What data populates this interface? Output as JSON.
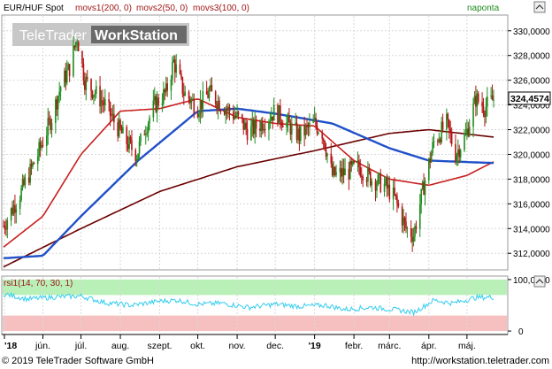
{
  "header": {
    "legend_instrument": "EUR/HUF Spot",
    "legend_ma1": "movs1(200, 0)",
    "legend_ma2": "movs2(50, 0)",
    "legend_ma3": "movs3(100, 0)",
    "period": "naponta",
    "watermark_text_1": "TeleTrader",
    "watermark_text_2": "WorkStation"
  },
  "footer": {
    "copyright": "© 2019 TeleTrader Software GmbH",
    "website": "http://workstation.teletrader.com"
  },
  "colors": {
    "candle_up": "#1e8c1e",
    "candle_down": "#b41414",
    "ma200": "#6b0000",
    "ma50": "#c81e1e",
    "ma100": "#2050c8",
    "rsi_line": "#33ccee",
    "rsi_overbought_band": "#b8f0b8",
    "rsi_oversold_band": "#f6c0c0",
    "last_price_box": "#ffffff"
  },
  "chart_data": [
    {
      "type": "candlestick",
      "series_name": "EUR/HUF Spot",
      "frequency": "naponta",
      "last_value": "324,4574",
      "ylim": [
        310.8,
        331.2
      ],
      "y_ticks": [
        "312,0000",
        "314,0000",
        "316,0000",
        "318,0000",
        "320,0000",
        "322,0000",
        "324,0000",
        "326,0000",
        "328,0000",
        "330,0000"
      ],
      "y_tick_values": [
        312,
        314,
        316,
        318,
        320,
        322,
        324,
        326,
        328,
        330
      ],
      "x_tick_labels": [
        "'18",
        "jún.",
        "júl.",
        "aug.",
        "szept.",
        "okt.",
        "nov.",
        "dec.",
        "'19",
        "febr.",
        "márc.",
        "ápr.",
        "máj."
      ],
      "close_anchors": [
        [
          "2018-05-01",
          314.2
        ],
        [
          "2018-05-15",
          317.0
        ],
        [
          "2018-05-28",
          320.0
        ],
        [
          "2018-06-08",
          323.0
        ],
        [
          "2018-06-15",
          325.5
        ],
        [
          "2018-06-22",
          327.0
        ],
        [
          "2018-06-28",
          329.5
        ],
        [
          "2018-07-04",
          326.0
        ],
        [
          "2018-07-12",
          325.0
        ],
        [
          "2018-07-20",
          324.0
        ],
        [
          "2018-07-28",
          322.5
        ],
        [
          "2018-08-06",
          321.0
        ],
        [
          "2018-08-14",
          320.0
        ],
        [
          "2018-08-20",
          322.0
        ],
        [
          "2018-08-28",
          324.0
        ],
        [
          "2018-09-06",
          325.0
        ],
        [
          "2018-09-12",
          327.5
        ],
        [
          "2018-09-20",
          325.0
        ],
        [
          "2018-10-01",
          323.8
        ],
        [
          "2018-10-10",
          325.0
        ],
        [
          "2018-10-20",
          324.0
        ],
        [
          "2018-11-01",
          323.0
        ],
        [
          "2018-11-10",
          321.8
        ],
        [
          "2018-11-20",
          322.5
        ],
        [
          "2018-12-01",
          323.5
        ],
        [
          "2018-12-10",
          322.5
        ],
        [
          "2018-12-20",
          321.5
        ],
        [
          "2019-01-01",
          322.5
        ],
        [
          "2019-01-07",
          321.8
        ],
        [
          "2019-01-15",
          318.3
        ],
        [
          "2019-01-25",
          318.5
        ],
        [
          "2019-02-05",
          319.0
        ],
        [
          "2019-02-15",
          318.0
        ],
        [
          "2019-02-25",
          317.5
        ],
        [
          "2019-03-05",
          316.5
        ],
        [
          "2019-03-14",
          314.0
        ],
        [
          "2019-03-20",
          313.5
        ],
        [
          "2019-03-28",
          317.5
        ],
        [
          "2019-04-05",
          321.0
        ],
        [
          "2019-04-15",
          322.5
        ],
        [
          "2019-04-22",
          320.0
        ],
        [
          "2019-04-30",
          321.5
        ],
        [
          "2019-05-08",
          324.5
        ],
        [
          "2019-05-15",
          323.8
        ],
        [
          "2019-05-22",
          324.46
        ]
      ],
      "ma200_anchors": [
        [
          "2018-05-01",
          310.9
        ],
        [
          "2018-07-01",
          314.0
        ],
        [
          "2018-09-01",
          317.0
        ],
        [
          "2018-11-01",
          319.0
        ],
        [
          "2019-01-01",
          320.3
        ],
        [
          "2019-03-01",
          321.7
        ],
        [
          "2019-04-01",
          322.0
        ],
        [
          "2019-05-22",
          321.4
        ]
      ],
      "ma100_anchors": [
        [
          "2018-05-01",
          311.6
        ],
        [
          "2018-06-01",
          311.8
        ],
        [
          "2018-07-01",
          315.0
        ],
        [
          "2018-08-15",
          319.5
        ],
        [
          "2018-10-01",
          323.5
        ],
        [
          "2018-11-01",
          323.7
        ],
        [
          "2018-12-01",
          323.3
        ],
        [
          "2019-01-15",
          322.5
        ],
        [
          "2019-03-01",
          320.5
        ],
        [
          "2019-04-01",
          319.5
        ],
        [
          "2019-05-22",
          319.3
        ]
      ],
      "ma50_anchors": [
        [
          "2018-05-01",
          312.5
        ],
        [
          "2018-06-01",
          315.0
        ],
        [
          "2018-07-01",
          320.0
        ],
        [
          "2018-08-01",
          323.5
        ],
        [
          "2018-09-01",
          323.7
        ],
        [
          "2018-10-01",
          324.5
        ],
        [
          "2018-11-01",
          323.0
        ],
        [
          "2018-12-01",
          322.5
        ],
        [
          "2019-01-01",
          322.3
        ],
        [
          "2019-02-01",
          319.5
        ],
        [
          "2019-03-01",
          318.0
        ],
        [
          "2019-04-01",
          317.5
        ],
        [
          "2019-05-01",
          318.3
        ],
        [
          "2019-05-22",
          319.4
        ]
      ]
    },
    {
      "type": "line",
      "series_name": "rsi1(14, 70, 30, 1)",
      "ylim": [
        -5,
        105
      ],
      "y_ticks": [
        "100,0000",
        "0"
      ],
      "y_tick_values": [
        100,
        0
      ],
      "overbought": 70,
      "oversold": 30,
      "rsi_anchors": [
        [
          "2018-05-01",
          72
        ],
        [
          "2018-05-20",
          62
        ],
        [
          "2018-06-10",
          66
        ],
        [
          "2018-07-01",
          68
        ],
        [
          "2018-07-20",
          55
        ],
        [
          "2018-08-10",
          50
        ],
        [
          "2018-09-01",
          58
        ],
        [
          "2018-09-15",
          60
        ],
        [
          "2018-10-01",
          52
        ],
        [
          "2018-10-20",
          54
        ],
        [
          "2018-11-10",
          46
        ],
        [
          "2018-12-01",
          52
        ],
        [
          "2018-12-20",
          48
        ],
        [
          "2019-01-10",
          50
        ],
        [
          "2019-01-25",
          42
        ],
        [
          "2019-02-15",
          46
        ],
        [
          "2019-03-10",
          40
        ],
        [
          "2019-03-20",
          36
        ],
        [
          "2019-04-05",
          60
        ],
        [
          "2019-04-20",
          54
        ],
        [
          "2019-05-08",
          65
        ],
        [
          "2019-05-22",
          66
        ]
      ]
    }
  ]
}
